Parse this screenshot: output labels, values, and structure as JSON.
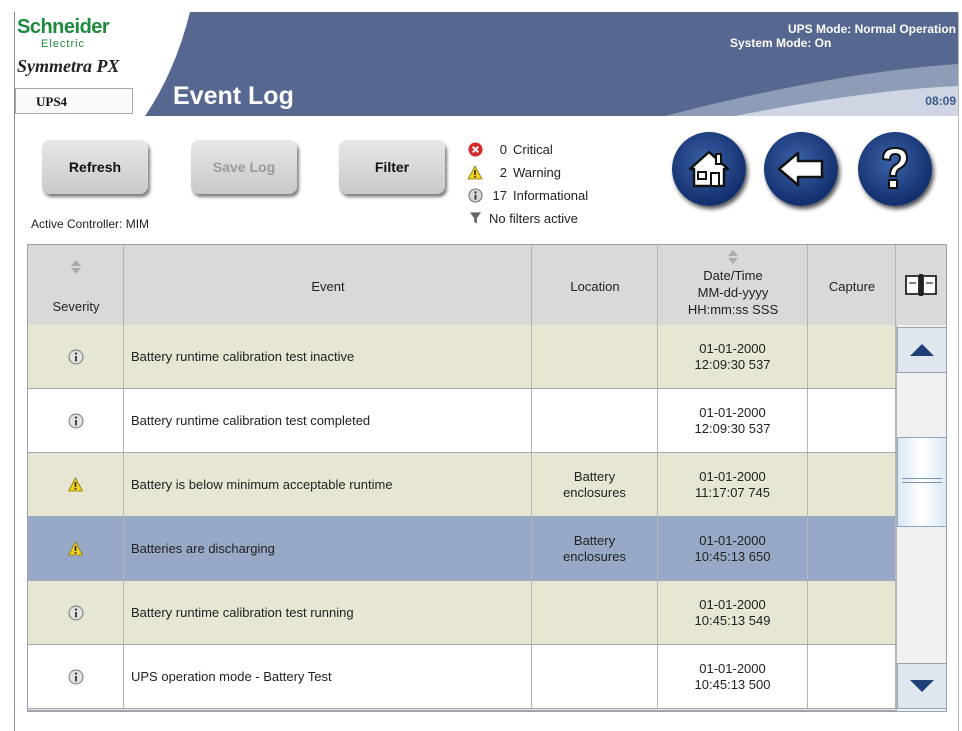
{
  "header": {
    "brand": "Schneider",
    "brand_sub": "Electric",
    "product": "Symmetra PX",
    "unit": "UPS4",
    "title": "Event Log",
    "ups_mode": "UPS Mode: Normal Operation",
    "system_mode": "System Mode: On",
    "time": "08:09"
  },
  "toolbar": {
    "refresh_label": "Refresh",
    "save_label": "Save Log",
    "filter_label": "Filter",
    "controller": "Active Controller: MIM"
  },
  "summary": {
    "critical_count": "0",
    "critical_label": "Critical",
    "warning_count": "2",
    "warning_label": "Warning",
    "info_count": "17",
    "info_label": "Informational",
    "filters": "No filters active"
  },
  "nav": {
    "home": "home-icon",
    "back": "back-arrow-icon",
    "help": "help-icon"
  },
  "table": {
    "headers": {
      "severity": "Severity",
      "event": "Event",
      "location": "Location",
      "datetime_1": "Date/Time",
      "datetime_2": "MM-dd-yyyy",
      "datetime_3": "HH:mm:ss SSS",
      "capture": "Capture"
    },
    "rows": [
      {
        "severity": "info",
        "event": "Battery runtime calibration test inactive",
        "location_1": "",
        "location_2": "",
        "date": "01-01-2000",
        "time": "12:09:30 537",
        "bg": "#e6e6d2"
      },
      {
        "severity": "info",
        "event": "Battery runtime calibration test completed",
        "location_1": "",
        "location_2": "",
        "date": "01-01-2000",
        "time": "12:09:30 537",
        "bg": "#ffffff"
      },
      {
        "severity": "warning",
        "event": "Battery is below minimum acceptable runtime",
        "location_1": "Battery",
        "location_2": "enclosures",
        "date": "01-01-2000",
        "time": "11:17:07 745",
        "bg": "#e6e6d2"
      },
      {
        "severity": "warning",
        "event": "Batteries are discharging",
        "location_1": "Battery",
        "location_2": "enclosures",
        "date": "01-01-2000",
        "time": "10:45:13 650",
        "bg": "#97a9c6"
      },
      {
        "severity": "info",
        "event": "Battery runtime calibration test running",
        "location_1": "",
        "location_2": "",
        "date": "01-01-2000",
        "time": "10:45:13 549",
        "bg": "#e6e6d2"
      },
      {
        "severity": "info",
        "event": "UPS operation mode - Battery Test",
        "location_1": "",
        "location_2": "",
        "date": "01-01-2000",
        "time": "10:45:13 500",
        "bg": "#ffffff"
      }
    ]
  },
  "colors": {
    "header_blue": "#56688f",
    "brand_green": "#1e8a3c",
    "row_alt": "#e6e6d2",
    "row_selected": "#97a9c6"
  }
}
